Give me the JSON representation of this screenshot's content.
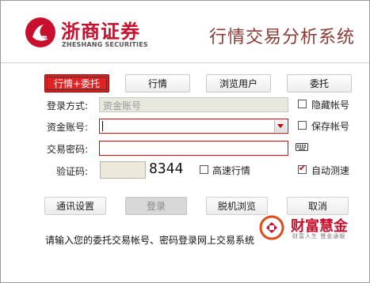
{
  "header": {
    "brand_cn": "浙商证券",
    "brand_en": "ZHESHANG SECURITIES",
    "app_title": "行情交易分析系统"
  },
  "tabs": [
    {
      "label": "行情+委托",
      "active": true
    },
    {
      "label": "行情",
      "active": false
    },
    {
      "label": "浏览用户",
      "active": false
    },
    {
      "label": "委托",
      "active": false
    }
  ],
  "form": {
    "login_mode_label": "登录方式:",
    "login_mode_value": "资金账号",
    "account_label": "资金账号:",
    "account_value": "",
    "password_label": "交易密码:",
    "password_value": "",
    "captcha_label": "验证码:",
    "captcha_value": "",
    "captcha_code": "8344"
  },
  "options": {
    "hide_account": {
      "label": "隐藏帐号",
      "checked": false
    },
    "save_account": {
      "label": "保存帐号",
      "checked": false
    },
    "fast_quote": {
      "label": "高速行情",
      "checked": false
    },
    "auto_speedtest": {
      "label": "自动测速",
      "checked": true
    }
  },
  "buttons": {
    "comm_settings": "通讯设置",
    "login": "登录",
    "offline_browse": "脱机浏览",
    "cancel": "取消"
  },
  "footer": {
    "note": "请输入您的委托交易帐号、密码登录网上交易系统",
    "partner_name": "财富慧金",
    "partner_slogan": "财富人生 慧金通银"
  },
  "colors": {
    "brand_red": "#c8102e",
    "title_brown": "#8c3a34",
    "active_tab": "#e12222"
  }
}
